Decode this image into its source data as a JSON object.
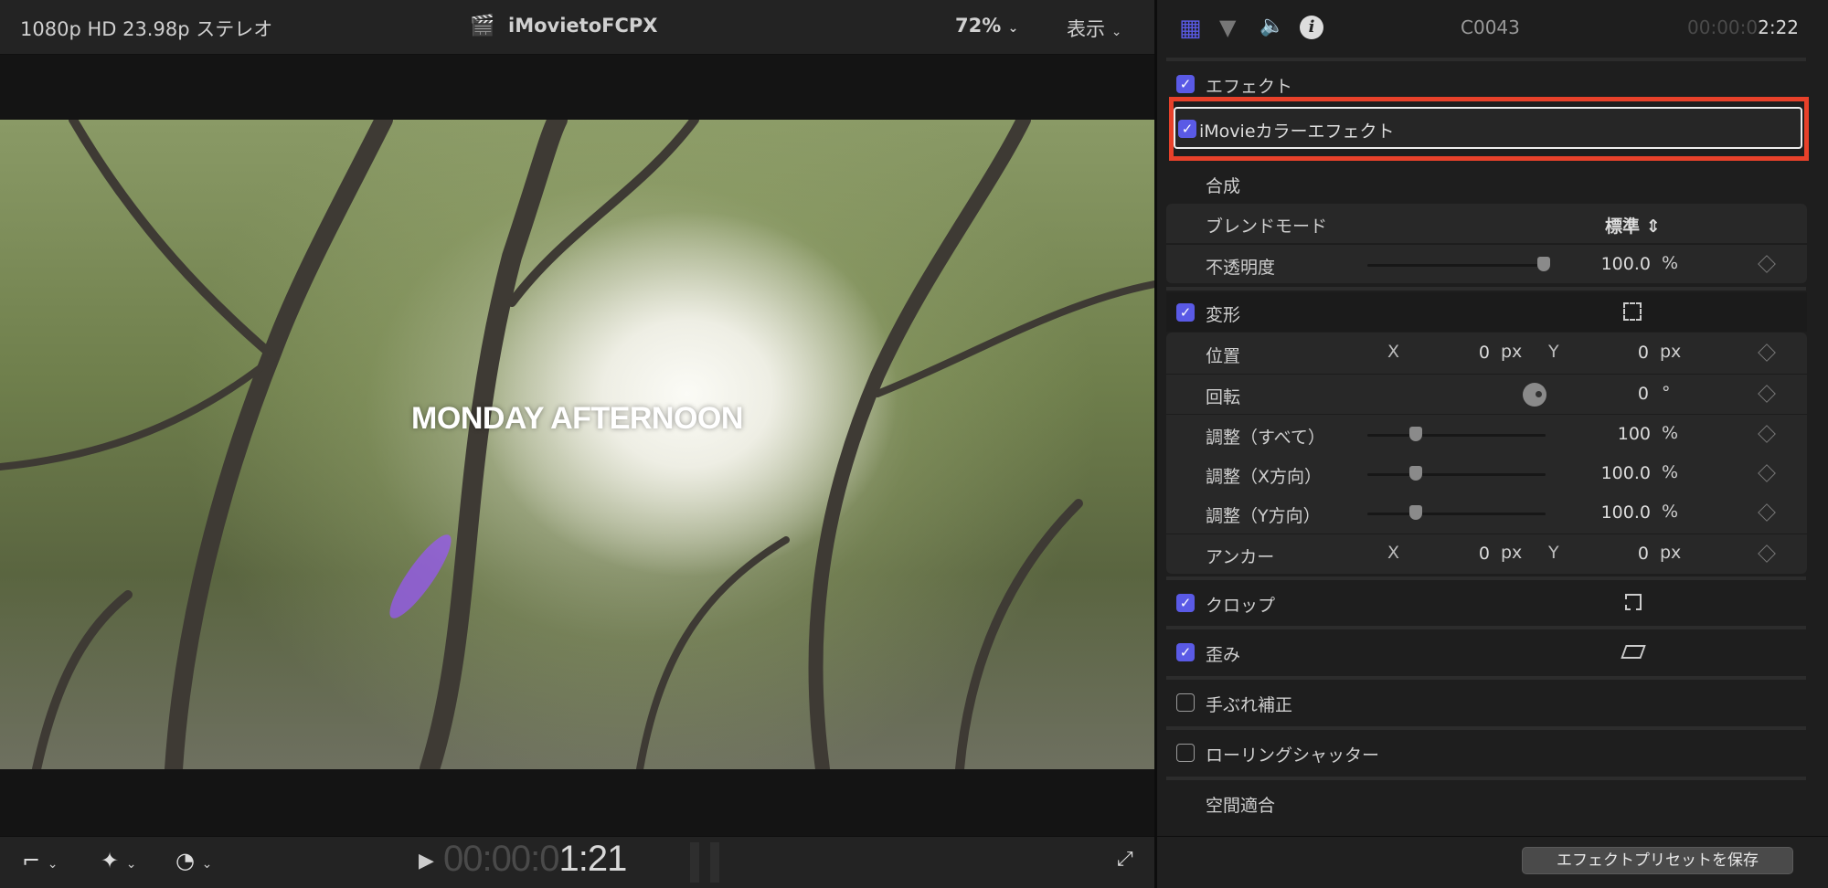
{
  "viewer": {
    "format": "1080p HD 23.98p ステレオ",
    "project_title": "iMovietoFCPX",
    "zoom": "72%",
    "view_menu": "表示",
    "video_title_text": "MONDAY AFTERNOON",
    "timecode_dim": "00:00:0",
    "timecode_bright": "1:21"
  },
  "inspector": {
    "clip_name": "C0043",
    "duration_dim": "00:00:0",
    "duration_bright": "2:22",
    "effects_label": "エフェクト",
    "effect_name": "iMovieカラーエフェクト",
    "compositing": "合成",
    "blend_mode_label": "ブレンドモード",
    "blend_mode_value": "標準",
    "opacity_label": "不透明度",
    "opacity_value": "100.0",
    "opacity_unit": "%",
    "opacity_fraction": 1.0,
    "transform": "変形",
    "position_label": "位置",
    "x": "X",
    "y": "Y",
    "px": "px",
    "position_x": "0",
    "position_y": "0",
    "rotation_label": "回転",
    "rotation_value": "0",
    "rotation_unit": "°",
    "scale_all_label": "調整（すべて）",
    "scale_all_value": "100",
    "scale_x_label": "調整（X方向）",
    "scale_x_value": "100.0",
    "scale_y_label": "調整（Y方向）",
    "scale_y_value": "100.0",
    "percent": "%",
    "anchor_label": "アンカー",
    "anchor_x": "0",
    "anchor_y": "0",
    "crop": "クロップ",
    "distort": "歪み",
    "stabilization": "手ぶれ補正",
    "rolling_shutter": "ローリングシャッター",
    "spatial_conform": "空間適合",
    "save_preset": "エフェクトプリセットを保存"
  },
  "colors": {
    "accent": "#5a5ae6",
    "highlight": "#e8412a"
  }
}
